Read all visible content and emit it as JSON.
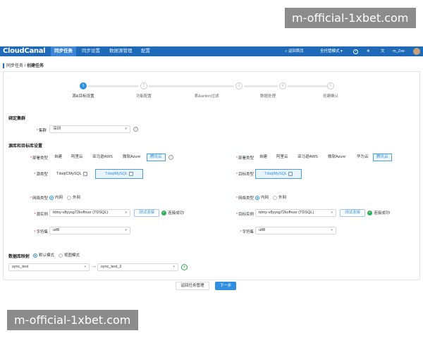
{
  "watermarks": {
    "top": "m-official-1xbet.com",
    "bottom": "m-official-1xbet.com"
  },
  "header": {
    "logo": "CloudCanal",
    "nav": [
      "同步任务",
      "同步设置",
      "数据源管理",
      "配置"
    ],
    "back_home": "返回首页",
    "mode": "全托管模式",
    "user": "m_Zoe"
  },
  "breadcrumb": {
    "parent": "同步任务",
    "sep": "/",
    "current": "创建任务"
  },
  "steps": [
    {
      "num": "1",
      "label": "源&目标设置"
    },
    {
      "num": "2",
      "label": "功能配置"
    },
    {
      "num": "3",
      "label": "表&action过滤"
    },
    {
      "num": "4",
      "label": "数据处理"
    },
    {
      "num": "5",
      "label": "创建确认"
    }
  ],
  "cluster": {
    "section": "绑定集群",
    "label": "集群",
    "value": "深圳"
  },
  "db_section": "源库和目标库设置",
  "source": {
    "deploy_label": "部署类型",
    "deploy_tabs": [
      "自建",
      "阿里云",
      "亚马逊AWS",
      "微软Azure",
      "腾讯云"
    ],
    "type_label": "源类型",
    "types": [
      "TdsqlCMySQL",
      "TdsqlMySQL"
    ],
    "net_label": "网络类型",
    "net_options": [
      "内网",
      "外网"
    ],
    "inst_label": "源实例",
    "inst_value": "tdmy-v8yysg72kvfhusr (TDSQL)",
    "test_btn": "测试连接",
    "ok_text": "连接成功!",
    "charset_label": "字符集",
    "charset_value": "utf8"
  },
  "target": {
    "deploy_label": "部署类型",
    "deploy_tabs": [
      "自建",
      "阿里云",
      "亚马逊AWS",
      "微软Azure",
      "华为云",
      "腾讯云"
    ],
    "type_label": "目标类型",
    "types": [
      "TdsqlMySQL"
    ],
    "net_label": "网络类型",
    "net_options": [
      "内网",
      "外网"
    ],
    "inst_label": "目标实例",
    "inst_value": "tdmy-v8yysg72kvfhusr (TDSQL)",
    "test_btn": "测试连接",
    "ok_text": "连接成功!",
    "charset_label": "字符集",
    "charset_value": "utf8"
  },
  "mapping": {
    "label": "数据库映射",
    "modes": [
      "默认模式",
      "视图模式"
    ],
    "source_db": "sync_test",
    "arrow": "→",
    "target_db": "sync_test_3"
  },
  "footer": {
    "back": "返回任务管理",
    "next": "下一步"
  },
  "colors": {
    "primary": "#2f8fe0",
    "topbar": "#1e6ab8",
    "success": "#2fae5a"
  }
}
